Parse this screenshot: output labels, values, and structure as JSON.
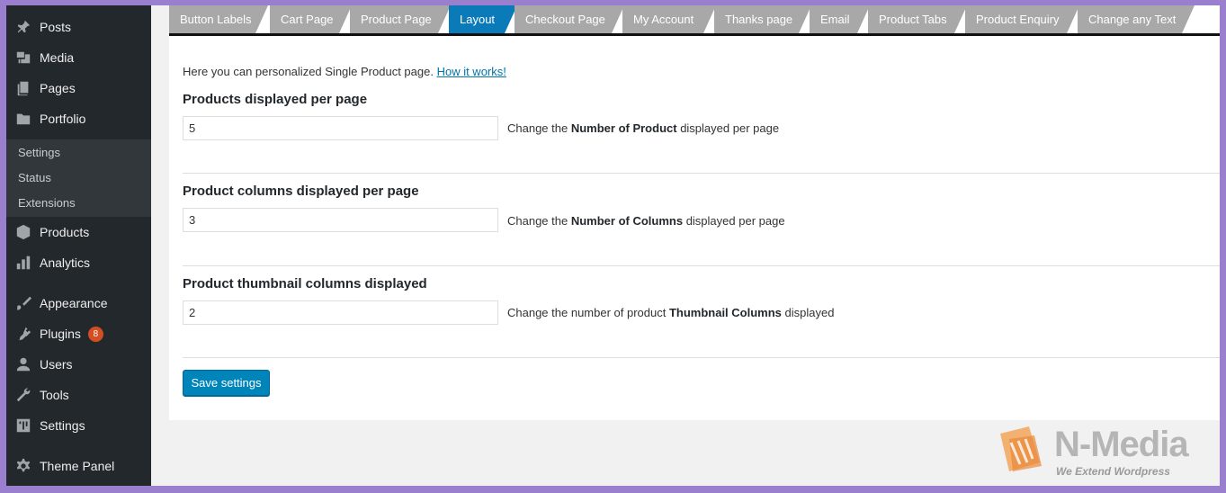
{
  "sidebar": {
    "items": [
      {
        "label": "Posts",
        "icon": "pin-icon"
      },
      {
        "label": "Media",
        "icon": "media-icon"
      },
      {
        "label": "Pages",
        "icon": "pages-icon"
      },
      {
        "label": "Portfolio",
        "icon": "folder-icon"
      },
      {
        "label": "Products",
        "icon": "box-icon"
      },
      {
        "label": "Analytics",
        "icon": "bar-chart-icon"
      },
      {
        "label": "Appearance",
        "icon": "brush-icon"
      },
      {
        "label": "Plugins",
        "icon": "plug-icon",
        "badge": "8"
      },
      {
        "label": "Users",
        "icon": "user-icon"
      },
      {
        "label": "Tools",
        "icon": "wrench-icon"
      },
      {
        "label": "Settings",
        "icon": "settings-sliders-icon"
      },
      {
        "label": "Theme Panel",
        "icon": "gear-icon"
      }
    ],
    "submenu": [
      "Settings",
      "Status",
      "Extensions"
    ]
  },
  "tabs": [
    {
      "label": "Button Labels"
    },
    {
      "label": "Cart Page"
    },
    {
      "label": "Product Page"
    },
    {
      "label": "Layout",
      "active": true
    },
    {
      "label": "Checkout Page"
    },
    {
      "label": "My Account"
    },
    {
      "label": "Thanks page"
    },
    {
      "label": "Email"
    },
    {
      "label": "Product Tabs"
    },
    {
      "label": "Product Enquiry"
    },
    {
      "label": "Change any Text"
    }
  ],
  "intro": {
    "text": "Here you can personalized Single Product page. ",
    "link": "How it works!"
  },
  "fields": [
    {
      "title": "Products displayed per page",
      "value": "5",
      "desc_pre": "Change the ",
      "desc_bold": "Number of Product",
      "desc_post": " displayed per page"
    },
    {
      "title": "Product columns displayed per page",
      "value": "3",
      "desc_pre": "Change the ",
      "desc_bold": "Number of Columns",
      "desc_post": " displayed per page"
    },
    {
      "title": "Product thumbnail columns displayed",
      "value": "2",
      "desc_pre": "Change the number of product ",
      "desc_bold": "Thumbnail Columns",
      "desc_post": " displayed"
    }
  ],
  "save_label": "Save settings",
  "logo": {
    "name": "N-Media",
    "tagline": "We Extend Wordpress"
  },
  "colors": {
    "accent": "#0085ba",
    "active_tab": "#0b7ab8",
    "sidebar": "#23282d",
    "badge": "#d54e21"
  }
}
